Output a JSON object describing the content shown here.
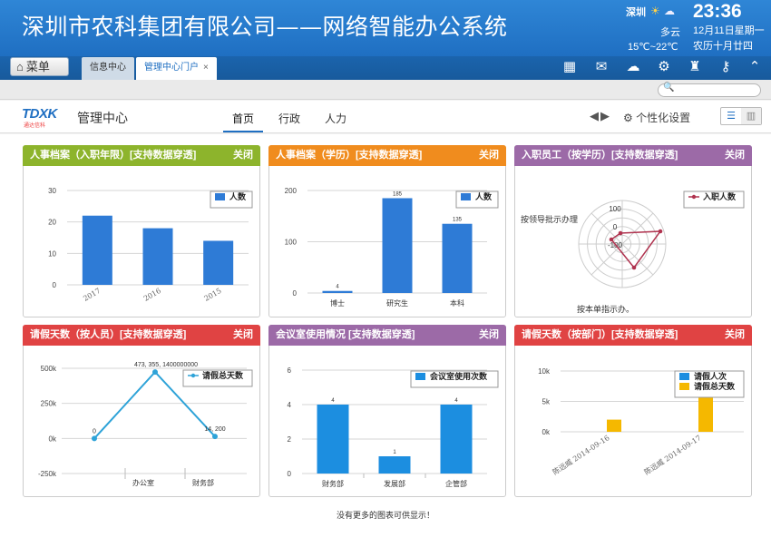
{
  "app_title": "深圳市农科集团有限公司——网络智能办公系统",
  "weather": {
    "city": "深圳",
    "condition": "多云",
    "temp": "15℃~22℃"
  },
  "clock": {
    "time": "23:36",
    "date": "12月11日星期一",
    "lunar": "农历十月廿四"
  },
  "menu_label": "菜单",
  "tabs": [
    {
      "label": "信息中心",
      "active": false
    },
    {
      "label": "管理中心门户",
      "active": true
    }
  ],
  "tab_close": "×",
  "toolbar_icons": [
    "grid-icon",
    "mail-icon",
    "upload-icon",
    "settings-icon",
    "shirt-icon",
    "key-icon",
    "chevron-up-icon"
  ],
  "search": {
    "value": "",
    "placeholder": ""
  },
  "logo_text": "TDXK",
  "logo_sub": "通达信科",
  "sub_title": "管理中心",
  "nav": [
    "首页",
    "行政",
    "人力"
  ],
  "personal_label": "个性化设置",
  "close_label": "关闭",
  "footer_note": "没有更多的图表可供显示！",
  "panels": [
    {
      "title": "人事档案（入职年限）[支持数据穿透]",
      "color": "#8db42c"
    },
    {
      "title": "人事档案（学历）[支持数据穿透]",
      "color": "#f08c1e"
    },
    {
      "title": "入职员工（按学历）[支持数据穿透]",
      "color": "#9c6aa7"
    },
    {
      "title": "请假天数（按人员）[支持数据穿透]",
      "color": "#e04343"
    },
    {
      "title": "会议室使用情况 [支持数据穿透]",
      "color": "#9c6aa7"
    },
    {
      "title": "请假天数（按部门）[支持数据穿透]",
      "color": "#e04343"
    }
  ],
  "chart_data": [
    {
      "type": "bar",
      "categories": [
        "2017",
        "2016",
        "2015"
      ],
      "series": [
        {
          "name": "人数",
          "values": [
            22,
            18,
            14
          ]
        }
      ],
      "yticks": [
        "0",
        "10",
        "20",
        "30"
      ],
      "ylim": [
        0,
        30
      ],
      "legend": "top-right",
      "color": "#2e7bd6",
      "grid": true
    },
    {
      "type": "bar",
      "categories": [
        "博士",
        "研究生",
        "本科"
      ],
      "series": [
        {
          "name": "人数",
          "values": [
            4,
            185,
            135
          ]
        }
      ],
      "data_labels": [
        "4",
        "185",
        "135"
      ],
      "yticks": [
        "0",
        "100",
        "200"
      ],
      "ylim": [
        0,
        200
      ],
      "legend": "top-right",
      "color": "#2e7bd6",
      "grid": true
    },
    {
      "type": "radar",
      "axes": [
        "按领导批示办理",
        "按本单指示办。"
      ],
      "series": [
        {
          "name": "入职人数"
        }
      ],
      "rticks": [
        "100",
        "0",
        "-100"
      ],
      "legend": "top-right",
      "color": "#b0334f"
    },
    {
      "type": "line",
      "categories": [
        "",
        "办公室",
        "财务部"
      ],
      "series": [
        {
          "name": "请假总天数",
          "values": [
            0,
            473355,
            14200
          ]
        }
      ],
      "data_labels": [
        "0",
        "473, 355, 1400000000",
        "14, 200"
      ],
      "yticks": [
        "-250k",
        "0k",
        "250k",
        "500k"
      ],
      "ylim": [
        -250000,
        500000
      ],
      "legend": "top-right",
      "color": "#2ea3d8",
      "grid": true
    },
    {
      "type": "bar",
      "categories": [
        "财务部",
        "发展部",
        "企管部"
      ],
      "series": [
        {
          "name": "会议室使用次数",
          "values": [
            4,
            1,
            4
          ]
        }
      ],
      "data_labels": [
        "4",
        "1",
        "4"
      ],
      "yticks": [
        "0",
        "2",
        "4",
        "6"
      ],
      "ylim": [
        0,
        6
      ],
      "legend": "top-right",
      "color": "#1c8ee0",
      "grid": true
    },
    {
      "type": "bar",
      "categories": [
        "陈远威 2014-09-16",
        "陈远威 2014-09-17"
      ],
      "series": [
        {
          "name": "请假人次",
          "values": [
            0,
            0
          ],
          "color": "#1c8ee0"
        },
        {
          "name": "请假总天数",
          "values": [
            2000,
            6000
          ],
          "color": "#f5b800"
        }
      ],
      "yticks": [
        "0k",
        "5k",
        "10k"
      ],
      "ylim": [
        0,
        10000
      ],
      "legend": "top-right",
      "grid": true
    }
  ]
}
